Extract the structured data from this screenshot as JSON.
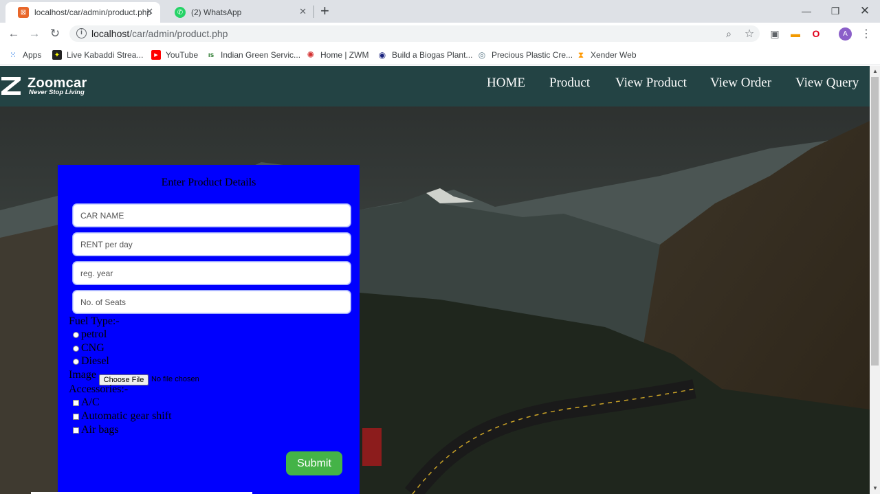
{
  "browser": {
    "tabs": [
      {
        "title": "localhost/car/admin/product.php",
        "active": true
      },
      {
        "title": "(2) WhatsApp",
        "active": false
      }
    ],
    "url_host": "localhost",
    "url_path": "/car/admin/product.php",
    "profile_initial": "A",
    "bookmarks": [
      {
        "label": "Apps"
      },
      {
        "label": "Live Kabaddi Strea..."
      },
      {
        "label": "YouTube"
      },
      {
        "label": "Indian Green Servic..."
      },
      {
        "label": "Home | ZWM"
      },
      {
        "label": "Build a Biogas Plant..."
      },
      {
        "label": "Precious Plastic Cre..."
      },
      {
        "label": "Xender Web"
      }
    ]
  },
  "site": {
    "brand": "Zoomcar",
    "tagline": "Never Stop Living",
    "nav": [
      "HOME",
      "Product",
      "View Product",
      "View Order",
      "View Query"
    ],
    "nav_bg": "#234344"
  },
  "form": {
    "title": "Enter Product Details",
    "panel_color": "#0000fe",
    "fields": [
      {
        "placeholder": "CAR NAME"
      },
      {
        "placeholder": "RENT per day"
      },
      {
        "placeholder": "reg. year"
      },
      {
        "placeholder": "No. of Seats"
      }
    ],
    "fuel_label": "Fuel Type:-",
    "fuel_options": [
      "petrol",
      "CNG",
      "Diesel"
    ],
    "image_label": "Image",
    "choose_file": "Choose File",
    "no_file": "No file chosen",
    "accessories_label": "Accessories:-",
    "accessories": [
      "A/C",
      "Automatic gear shift",
      "Air bags"
    ],
    "submit": "Submit",
    "submit_color": "#44b347"
  }
}
